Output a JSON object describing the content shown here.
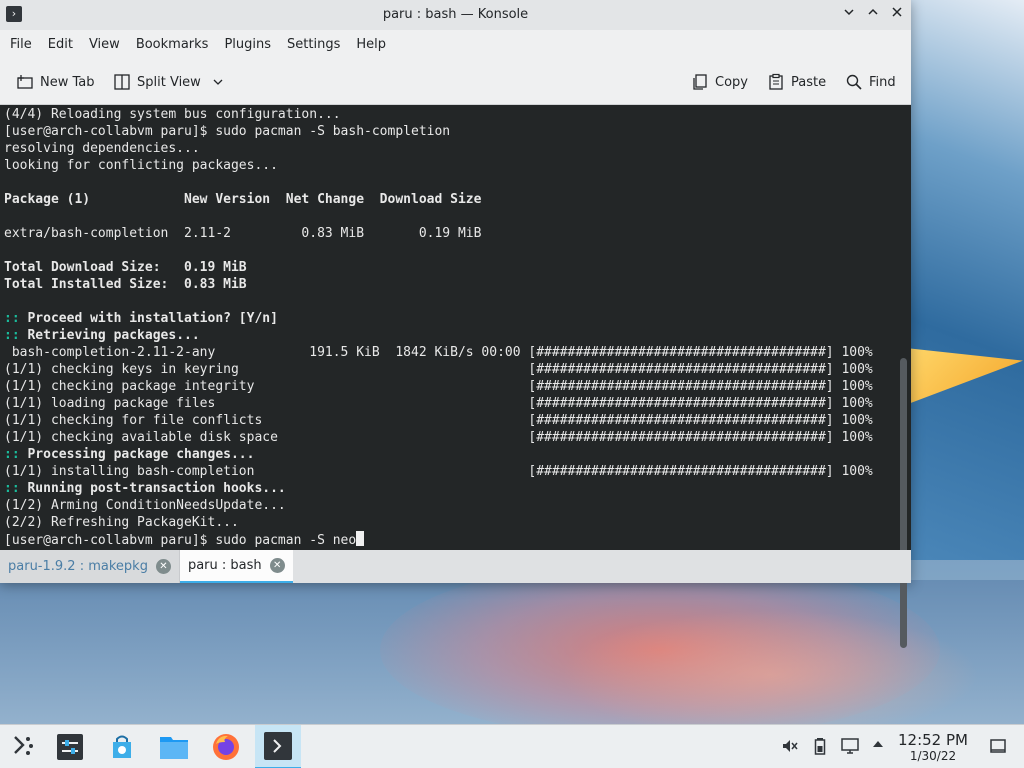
{
  "window": {
    "title": "paru : bash — Konsole",
    "app_icon": "terminal-icon",
    "controls": {
      "minimize": "⌄",
      "maximize": "⌃",
      "close": "✕"
    }
  },
  "menu": [
    "File",
    "Edit",
    "View",
    "Bookmarks",
    "Plugins",
    "Settings",
    "Help"
  ],
  "toolbar": {
    "new_tab": "New Tab",
    "split_view": "Split View",
    "copy": "Copy",
    "paste": "Paste",
    "find": "Find"
  },
  "terminal": {
    "lines": [
      {
        "prefix": "",
        "text": "(4/4) Reloading system bus configuration...",
        "bold": false
      },
      {
        "prefix": "",
        "text": "[user@arch-collabvm paru]$ sudo pacman -S bash-completion",
        "bold": false
      },
      {
        "prefix": "",
        "text": "resolving dependencies...",
        "bold": false
      },
      {
        "prefix": "",
        "text": "looking for conflicting packages...",
        "bold": false
      },
      {
        "prefix": "",
        "text": "",
        "bold": false
      },
      {
        "prefix": "",
        "text": "Package (1)            New Version  Net Change  Download Size",
        "bold": true
      },
      {
        "prefix": "",
        "text": "",
        "bold": false
      },
      {
        "prefix": "",
        "text": "extra/bash-completion  2.11-2         0.83 MiB       0.19 MiB",
        "bold": false
      },
      {
        "prefix": "",
        "text": "",
        "bold": false
      },
      {
        "prefix": "",
        "text": "Total Download Size:   0.19 MiB",
        "bold": true
      },
      {
        "prefix": "",
        "text": "Total Installed Size:  0.83 MiB",
        "bold": true
      },
      {
        "prefix": "",
        "text": "",
        "bold": false
      },
      {
        "prefix": "::",
        "text": " Proceed with installation? [Y/n]",
        "bold": true
      },
      {
        "prefix": "::",
        "text": " Retrieving packages...",
        "bold": true
      },
      {
        "prefix": "",
        "text": " bash-completion-2.11-2-any            191.5 KiB  1842 KiB/s 00:00 [#####################################] 100%",
        "bold": false
      },
      {
        "prefix": "",
        "text": "(1/1) checking keys in keyring                                     [#####################################] 100%",
        "bold": false
      },
      {
        "prefix": "",
        "text": "(1/1) checking package integrity                                   [#####################################] 100%",
        "bold": false
      },
      {
        "prefix": "",
        "text": "(1/1) loading package files                                        [#####################################] 100%",
        "bold": false
      },
      {
        "prefix": "",
        "text": "(1/1) checking for file conflicts                                  [#####################################] 100%",
        "bold": false
      },
      {
        "prefix": "",
        "text": "(1/1) checking available disk space                                [#####################################] 100%",
        "bold": false
      },
      {
        "prefix": "::",
        "text": " Processing package changes...",
        "bold": true
      },
      {
        "prefix": "",
        "text": "(1/1) installing bash-completion                                   [#####################################] 100%",
        "bold": false
      },
      {
        "prefix": "::",
        "text": " Running post-transaction hooks...",
        "bold": true
      },
      {
        "prefix": "",
        "text": "(1/2) Arming ConditionNeedsUpdate...",
        "bold": false
      },
      {
        "prefix": "",
        "text": "(2/2) Refreshing PackageKit...",
        "bold": false
      }
    ],
    "prompt": "[user@arch-collabvm paru]$ sudo pacman -S neo"
  },
  "tabs": [
    {
      "label": "paru-1.9.2 : makepkg",
      "active": false
    },
    {
      "label": "paru : bash",
      "active": true
    }
  ],
  "taskbar": {
    "apps": [
      "application-launcher-icon",
      "system-settings-icon",
      "discover-store-icon",
      "file-manager-icon",
      "firefox-icon",
      "konsole-icon"
    ],
    "tray": [
      "volume-muted-icon",
      "battery-icon",
      "network-icon",
      "tray-expand-icon",
      "show-desktop-icon"
    ],
    "clock_time": "12:52 PM",
    "clock_date": "1/30/22"
  },
  "colors": {
    "terminal_bg": "#232627",
    "accent": "#3daee9",
    "prompt_marker": "#1abc9c"
  }
}
